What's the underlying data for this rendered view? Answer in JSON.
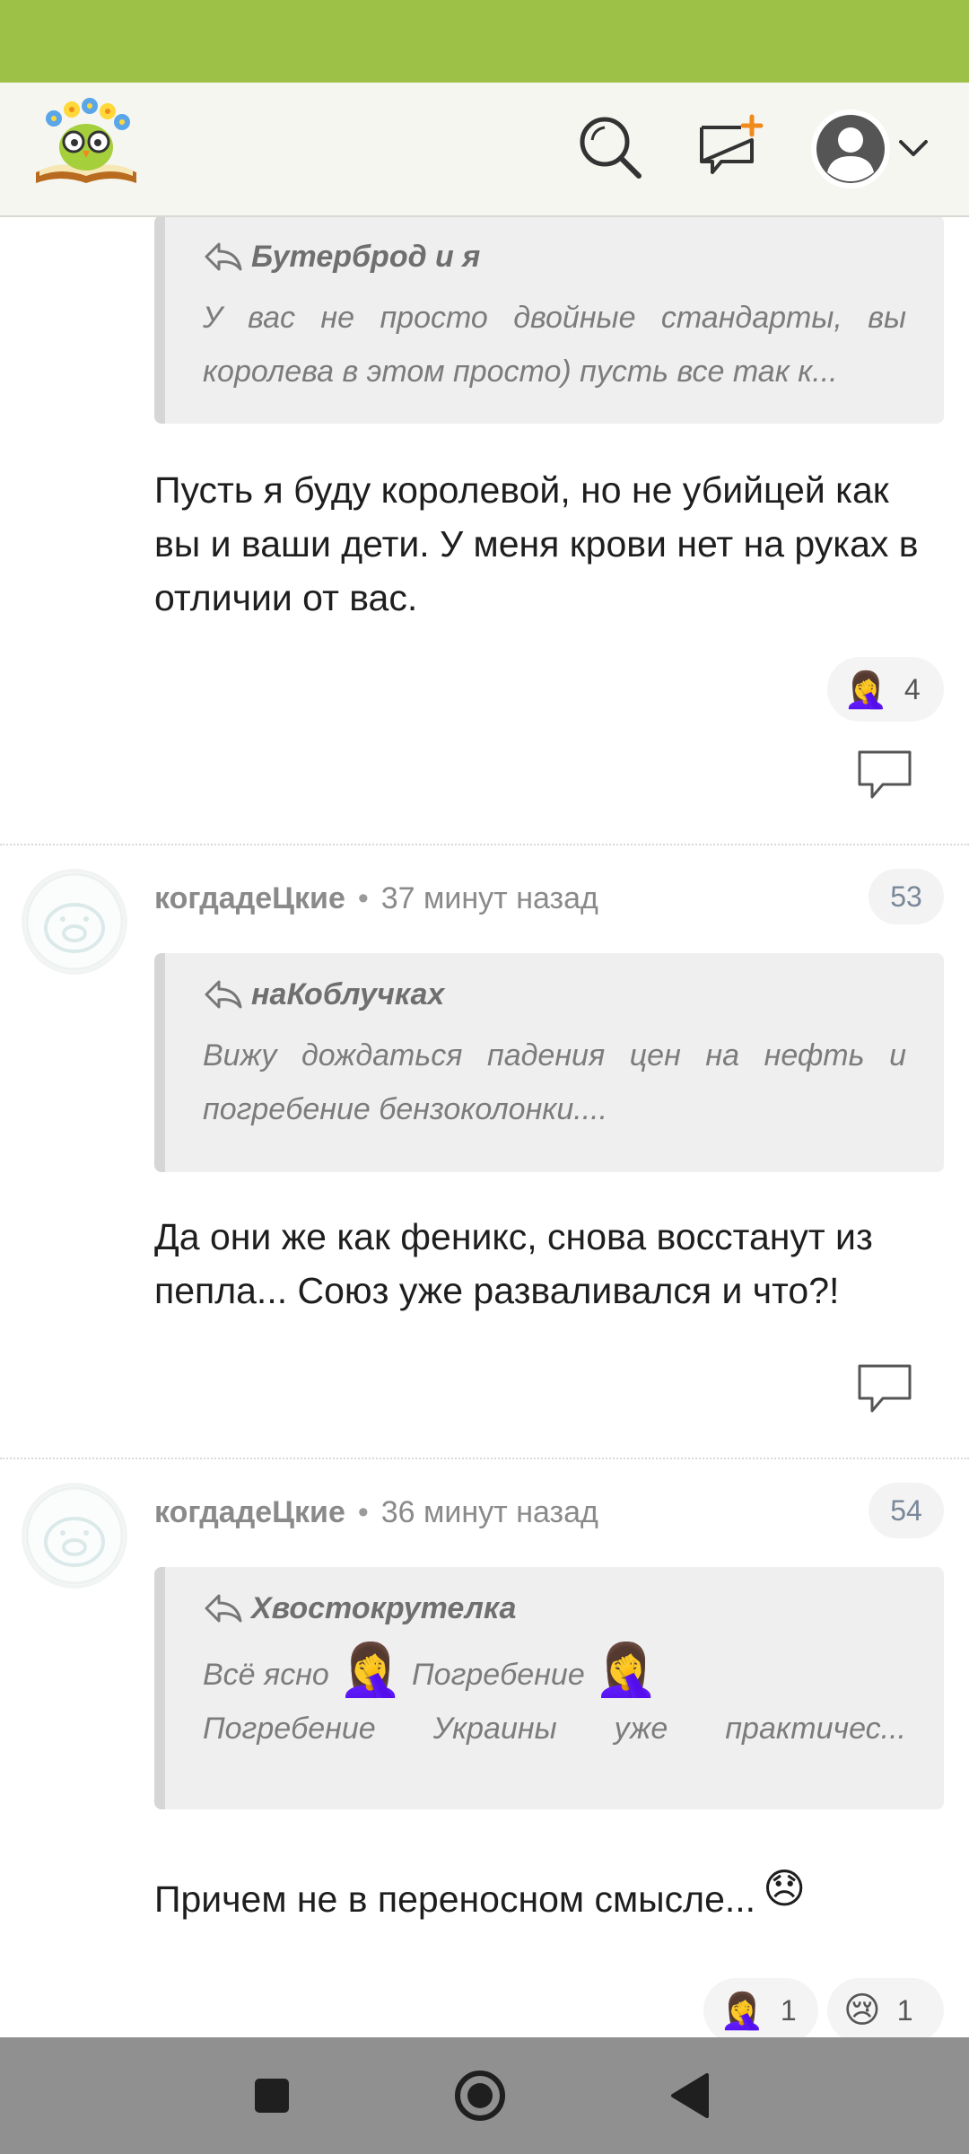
{
  "header": {
    "logo_icon": "owl-on-book-logo",
    "search_icon": "search-icon",
    "new_post_icon": "new-post-icon",
    "profile_icon": "user-avatar-icon",
    "dropdown_icon": "chevron-down-icon"
  },
  "comments": [
    {
      "quote": {
        "author": "Бутерброд и я",
        "lines": [
          "У вас не просто двойные стандарты, вы",
          "королева в этом просто) пусть все так к..."
        ]
      },
      "text": "Пусть я буду королевой, но не убийцей как вы и ваши дети. У меня крови нет на руках в отличии от вас.",
      "reactions": [
        {
          "emoji": "🤦‍♀️",
          "count": "4"
        }
      ]
    },
    {
      "author": "когдадеЦкие",
      "dot": "•",
      "time": "37 минут назад",
      "number": "53",
      "quote": {
        "author": "наКоблучках",
        "lines": [
          "Вижу дождаться падения цен на нефть и",
          "погребение бензоколонки...."
        ]
      },
      "text": "Да они же как феникс, снова восстанут из пепла... Союз уже разваливался и что?!"
    },
    {
      "author": "когдадеЦкие",
      "dot": "•",
      "time": "36 минут назад",
      "number": "54",
      "quote": {
        "author": "Хвостокрутелка",
        "line1_a": "Всё ясно",
        "emoji1": "🤦‍♀️",
        "line1_b": "Погребение",
        "emoji2": "🤦‍♀️",
        "line2": "Погребение Украины уже практичес..."
      },
      "text": "Причем не в переносном смысле...",
      "text_emoji": "😞",
      "reactions": [
        {
          "emoji": "🤦‍♀️",
          "count": "1"
        },
        {
          "emoji": "😢",
          "count": "1"
        }
      ]
    }
  ],
  "colors": {
    "status_bar": "#9dc147",
    "header_bg": "#f6f6f1",
    "nav_bar": "#909090",
    "accent_orange": "#f08a1d"
  }
}
